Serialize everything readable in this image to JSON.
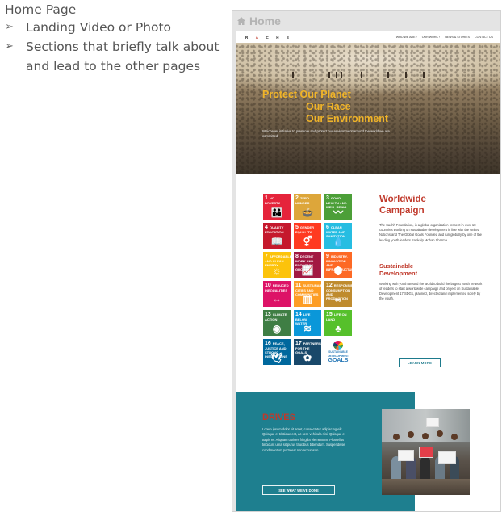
{
  "notes": {
    "title": "Home Page",
    "bullets": [
      "Landing Video or Photo",
      "Sections that briefly talk about and lead to the other pages"
    ],
    "bullet_glyph": "➢"
  },
  "frame": {
    "title": "Home",
    "icon": "home-icon"
  },
  "nav": {
    "logo_letters": [
      "R",
      "A",
      "C",
      "H",
      "E"
    ],
    "menu": [
      "WHO WE ARE ›",
      "OUR WORK ›",
      "NEWS & STORIES",
      "CONTACT US"
    ]
  },
  "hero": {
    "headline_1": "Protect Our Planet",
    "headline_2": "Our Race",
    "headline_3": "Our Environment",
    "subtext": "Whichever initiative to preserve and protect our environment around the world we are committed"
  },
  "sdg": {
    "tiles": [
      {
        "num": "1",
        "label": "NO POVERTY",
        "color": "#e5243b",
        "glyph": "👪"
      },
      {
        "num": "2",
        "label": "ZERO HUNGER",
        "color": "#dda63a",
        "glyph": "🍲"
      },
      {
        "num": "3",
        "label": "GOOD HEALTH AND WELL-BEING",
        "color": "#4c9f38",
        "glyph": "〰"
      },
      {
        "num": "4",
        "label": "QUALITY EDUCATION",
        "color": "#c5192d",
        "glyph": "📖"
      },
      {
        "num": "5",
        "label": "GENDER EQUALITY",
        "color": "#ff3a21",
        "glyph": "⚥"
      },
      {
        "num": "6",
        "label": "CLEAN WATER AND SANITATION",
        "color": "#26bde2",
        "glyph": "💧"
      },
      {
        "num": "7",
        "label": "AFFORDABLE AND CLEAN ENERGY",
        "color": "#fcc30b",
        "glyph": "☼"
      },
      {
        "num": "8",
        "label": "DECENT WORK AND ECONOMIC GROWTH",
        "color": "#a21942",
        "glyph": "📈"
      },
      {
        "num": "9",
        "label": "INDUSTRY, INNOVATION AND INFRASTRUCTURE",
        "color": "#fd6925",
        "glyph": "⬢"
      },
      {
        "num": "10",
        "label": "REDUCED INEQUALITIES",
        "color": "#dd1367",
        "glyph": "⇔"
      },
      {
        "num": "11",
        "label": "SUSTAINABLE CITIES AND COMMUNITIES",
        "color": "#fd9d24",
        "glyph": "▥"
      },
      {
        "num": "12",
        "label": "RESPONSIBLE CONSUMPTION AND PRODUCTION",
        "color": "#bf8b2e",
        "glyph": "∞"
      },
      {
        "num": "13",
        "label": "CLIMATE ACTION",
        "color": "#3f7e44",
        "glyph": "◉"
      },
      {
        "num": "14",
        "label": "LIFE BELOW WATER",
        "color": "#0a97d9",
        "glyph": "≋"
      },
      {
        "num": "15",
        "label": "LIFE ON LAND",
        "color": "#56c02b",
        "glyph": "♣"
      },
      {
        "num": "16",
        "label": "PEACE, JUSTICE AND STRONG INSTITUTIONS",
        "color": "#00689d",
        "glyph": "🕊"
      },
      {
        "num": "17",
        "label": "PARTNERSHIPS FOR THE GOALS",
        "color": "#19486a",
        "glyph": "✿"
      }
    ],
    "goals_tile": {
      "line1": "SUSTAINABLE",
      "line2": "DEVELOPMENT",
      "line3": "GOALS"
    }
  },
  "worldwide": {
    "title_1": "Worldwide",
    "title_2": "Campaign",
    "body": "The Sachh Foundation, is a global organization present in over 18 countries working on sustainable development in line with the United Nations and The Global Goals Founded and run globally by one of the leading youth leaders Sankalp Mohan Sharma.",
    "subtitle_1": "Sustainable",
    "subtitle_2": "Development",
    "body_2": "Working with youth around the world to build the largest youth network of leaders to start a worldwide campaign and project on Sustainable Development 17 SDGs, planned, directed and implemented solely by the youth.",
    "button": "LEARN MORE"
  },
  "drives": {
    "title": "DRIVES",
    "body": "Lorem ipsum dolor sit amet, consectetur adipiscing elit. Quisque et tristique est, ac sem vehicula nisi. Quisque et turpis et. Aliquam ultrices fringilla elementum. Phasellus tincidunt urna sit purus faucibus bibendum. Suspendisse condimentum porta est non accumsan.",
    "button": "SEE WHAT WE'VE DONE"
  }
}
